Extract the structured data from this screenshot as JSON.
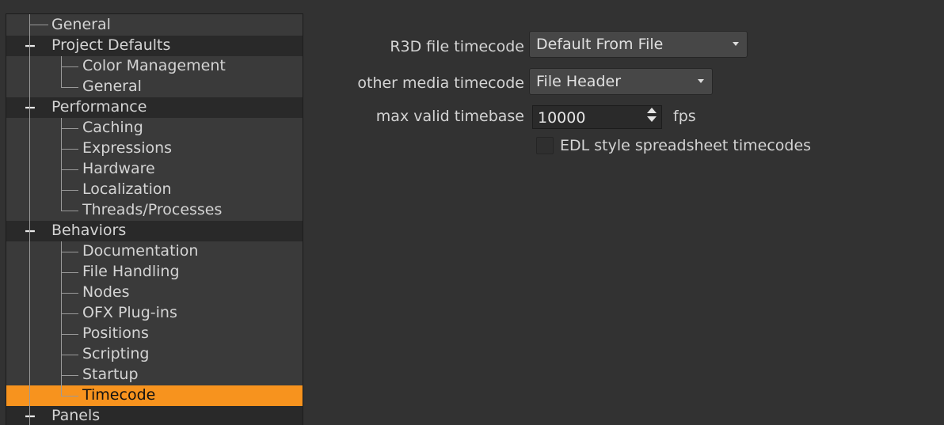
{
  "tree": {
    "items": [
      {
        "label": "General",
        "kind": "top"
      },
      {
        "label": "Project Defaults",
        "kind": "parent",
        "toggle": "−"
      },
      {
        "label": "Color Management",
        "kind": "child"
      },
      {
        "label": "General",
        "kind": "child"
      },
      {
        "label": "Performance",
        "kind": "parent",
        "toggle": "−"
      },
      {
        "label": "Caching",
        "kind": "child"
      },
      {
        "label": "Expressions",
        "kind": "child"
      },
      {
        "label": "Hardware",
        "kind": "child"
      },
      {
        "label": "Localization",
        "kind": "child"
      },
      {
        "label": "Threads/Processes",
        "kind": "child"
      },
      {
        "label": "Behaviors",
        "kind": "parent",
        "toggle": "−"
      },
      {
        "label": "Documentation",
        "kind": "child"
      },
      {
        "label": "File Handling",
        "kind": "child"
      },
      {
        "label": "Nodes",
        "kind": "child"
      },
      {
        "label": "OFX Plug-ins",
        "kind": "child"
      },
      {
        "label": "Positions",
        "kind": "child"
      },
      {
        "label": "Scripting",
        "kind": "child"
      },
      {
        "label": "Startup",
        "kind": "child"
      },
      {
        "label": "Timecode",
        "kind": "child",
        "selected": true
      },
      {
        "label": "Panels",
        "kind": "parent",
        "toggle": "−"
      }
    ]
  },
  "settings": {
    "r3d_label": "R3D file timecode",
    "r3d_value": "Default From File",
    "other_label": "other media timecode",
    "other_value": "File Header",
    "timebase_label": "max valid timebase",
    "timebase_value": "10000",
    "timebase_unit": "fps",
    "edl_label": "EDL style spreadsheet timecodes",
    "edl_checked": false
  },
  "colors": {
    "background": "#323232",
    "selection": "#f7931e",
    "tree_background": "#3a3a3a",
    "parent_row": "#292929"
  }
}
